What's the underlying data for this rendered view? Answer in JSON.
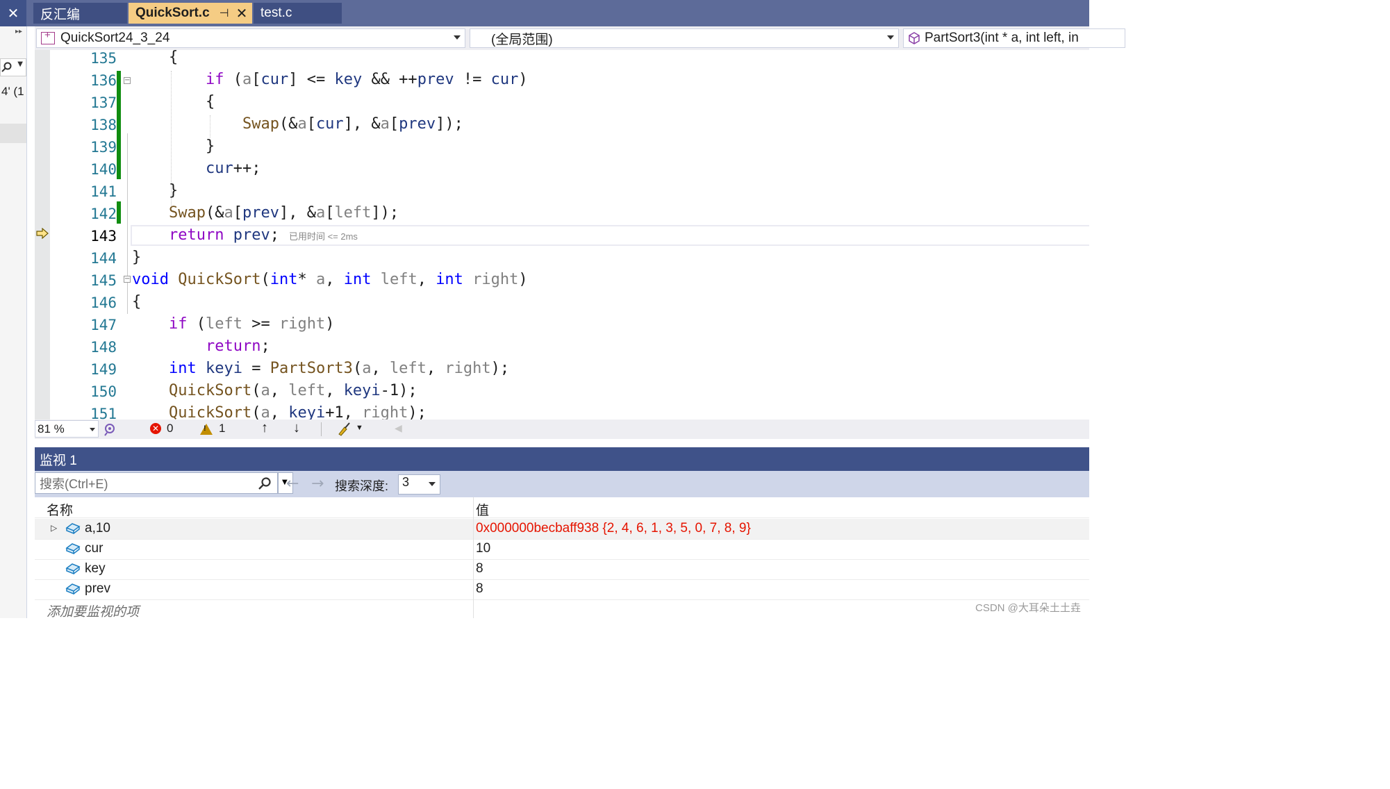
{
  "window": {
    "left_snippet": "4' (1",
    "tabs": [
      {
        "label": "反汇编"
      },
      {
        "label": "QuickSort.c",
        "pin": "⊣",
        "close": "✕"
      },
      {
        "label": "test.c"
      }
    ]
  },
  "navbar": {
    "project": "QuickSort24_3_24",
    "scope": "(全局范围)",
    "member": "PartSort3(int * a, int left, in"
  },
  "editor": {
    "current_line": 143,
    "perf_tip": "已用时间 <= 2ms",
    "line_numbers": [
      "135",
      "136",
      "137",
      "138",
      "139",
      "140",
      "141",
      "142",
      "143",
      "144",
      "145",
      "146",
      "147",
      "148",
      "149",
      "150",
      "151"
    ]
  },
  "status": {
    "zoom": "81 %",
    "errors": "0",
    "warnings": "1"
  },
  "watch": {
    "title": "监视 1",
    "search_placeholder": "搜索(Ctrl+E)",
    "depth_label": "搜索深度:",
    "depth_value": "3",
    "col_name": "名称",
    "col_value": "值",
    "rows": [
      {
        "name": "a,10",
        "value": "0x000000becbaff938 {2, 4, 6, 1, 3, 5, 0, 7, 8, 9}"
      },
      {
        "name": "cur",
        "value": "10"
      },
      {
        "name": "key",
        "value": "8"
      },
      {
        "name": "prev",
        "value": "8"
      }
    ],
    "add_item": "添加要监视的项"
  },
  "watermark": "CSDN @大耳朵土土垚",
  "colors": {
    "accent": "#3f5289",
    "active_tab": "#f5cc84",
    "changed_value": "#e51400",
    "change_bar": "#108c10"
  }
}
